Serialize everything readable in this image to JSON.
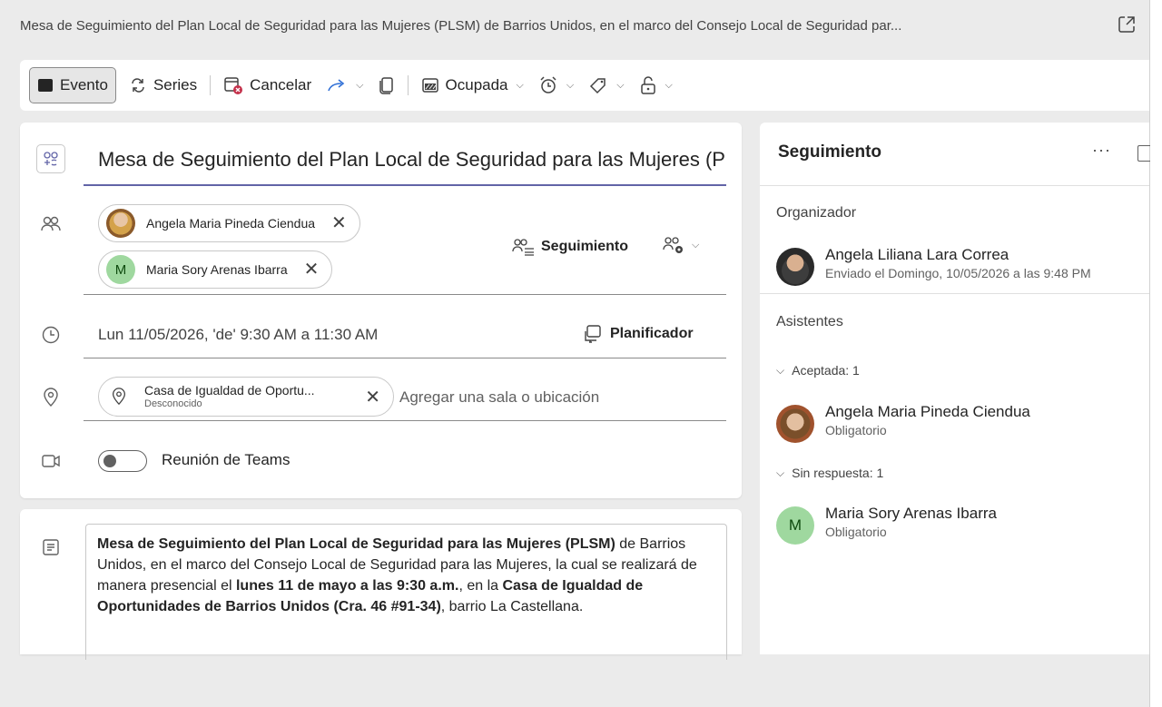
{
  "window": {
    "title": "Mesa de Seguimiento del Plan Local de Seguridad para las Mujeres (PLSM) de Barrios Unidos, en el marco del Consejo Local de Seguridad par..."
  },
  "toolbar": {
    "event_label": "Evento",
    "series_label": "Series",
    "cancel_label": "Cancelar",
    "busy_label": "Ocupada"
  },
  "details": {
    "subject": "Mesa de Seguimiento del Plan Local de Seguridad para las Mujeres (PLSM) de Barrios Unidos",
    "attendees": [
      {
        "name": "Angela Maria Pineda Ciendua"
      },
      {
        "name": "Maria Sory Arenas Ibarra",
        "initial": "M"
      }
    ],
    "tracking_label": "Seguimiento",
    "datetime": "Lun 11/05/2026, 'de' 9:30 AM a 11:30 AM",
    "scheduler_label": "Planificador",
    "location": {
      "name": "Casa de Igualdad de Oportu...",
      "status": "Desconocido",
      "placeholder": "Agregar una sala o ubicación"
    },
    "teams_label": "Reunión de Teams"
  },
  "description": {
    "p1_bold": "Mesa de Seguimiento del Plan Local de Seguridad para las Mujeres (PLSM)",
    "p1_rest": " de Barrios Unidos, en el marco del Consejo Local de Seguridad para las Mujeres, la cual se realizará de manera presencial el ",
    "date_bold": "lunes 11 de mayo a las 9:30 a.m.",
    "p2": ", en la ",
    "place_bold": "Casa de Igualdad de Oportunidades de Barrios Unidos (Cra. 46 #91-34)",
    "p3": ", barrio La Castellana."
  },
  "sidebar": {
    "title": "Seguimiento",
    "more": "···",
    "organizer_label": "Organizador",
    "organizer": {
      "name": "Angela Liliana Lara Correa",
      "sent": "Enviado el Domingo, 10/05/2026 a las 9:48 PM"
    },
    "attendees_label": "Asistentes",
    "accepted_label": "Aceptada: 1",
    "accepted": {
      "name": "Angela Maria Pineda Ciendua",
      "role": "Obligatorio"
    },
    "noresponse_label": "Sin respuesta: 1",
    "noresponse": {
      "name": "Maria Sory Arenas Ibarra",
      "role": "Obligatorio",
      "initial": "M"
    }
  }
}
